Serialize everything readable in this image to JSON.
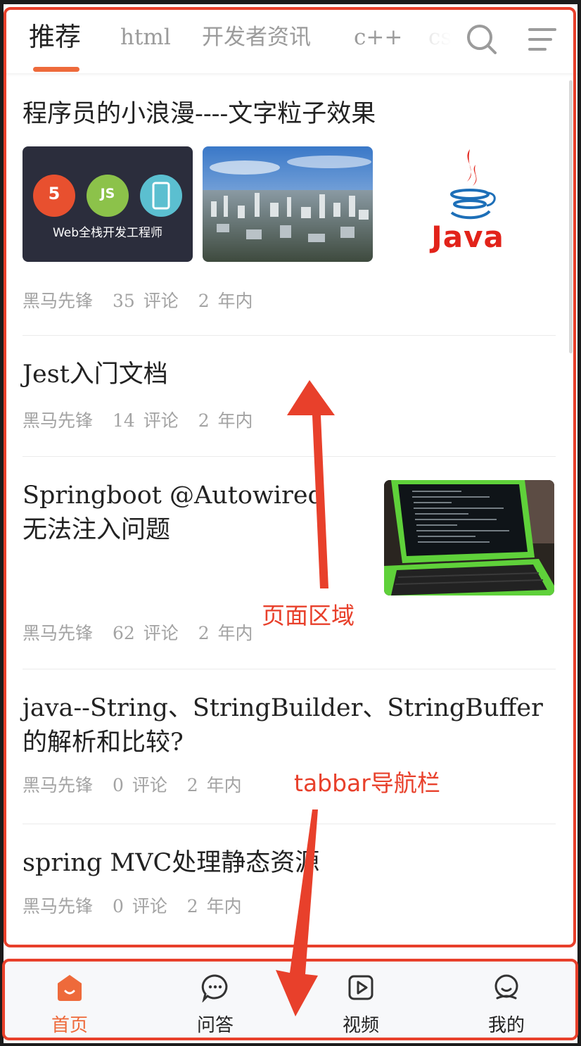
{
  "tabs": [
    {
      "label": "推荐",
      "active": true
    },
    {
      "label": "html",
      "active": false
    },
    {
      "label": "开发者资讯",
      "active": false
    },
    {
      "label": "c++",
      "active": false
    },
    {
      "label": "cs",
      "active": false
    }
  ],
  "icons": {
    "search": "search-icon",
    "menu": "hamburger-menu-icon"
  },
  "articles": [
    {
      "title": "程序员的小浪漫----文字粒子效果",
      "images": [
        {
          "name": "web-fullstack-image",
          "caption": "Web全栈开发工程师",
          "badges": [
            "5",
            "JS"
          ]
        },
        {
          "name": "city-aerial-image"
        },
        {
          "name": "java-logo-image",
          "caption": "Java"
        }
      ],
      "author": "黑马先锋",
      "comments": "35 评论",
      "time": "2 年内"
    },
    {
      "title": "Jest入门文档",
      "author": "黑马先锋",
      "comments": "14 评论",
      "time": "2 年内"
    },
    {
      "title": "Springboot @Autowired 无法注入问题",
      "images": [
        {
          "name": "laptop-code-image"
        }
      ],
      "author": "黑马先锋",
      "comments": "62 评论",
      "time": "2 年内"
    },
    {
      "title": "java--String、StringBuilder、StringBuffer的解析和比较?",
      "author": "黑马先锋",
      "comments": "0 评论",
      "time": "2 年内"
    },
    {
      "title": "spring MVC处理静态资源",
      "author": "黑马先锋",
      "comments": "0 评论",
      "time": "2 年内"
    }
  ],
  "annotations": {
    "page_area": "页面区域",
    "tabbar": "tabbar导航栏"
  },
  "bottom_tabs": [
    {
      "label": "首页",
      "icon": "home-icon",
      "active": true
    },
    {
      "label": "问答",
      "icon": "chat-bubble-icon",
      "active": false
    },
    {
      "label": "视频",
      "icon": "video-play-icon",
      "active": false
    },
    {
      "label": "我的",
      "icon": "profile-icon",
      "active": false
    }
  ],
  "colors": {
    "accent": "#ee6a3b",
    "annotation": "#e8402b",
    "meta_text": "#a3a3a3"
  }
}
